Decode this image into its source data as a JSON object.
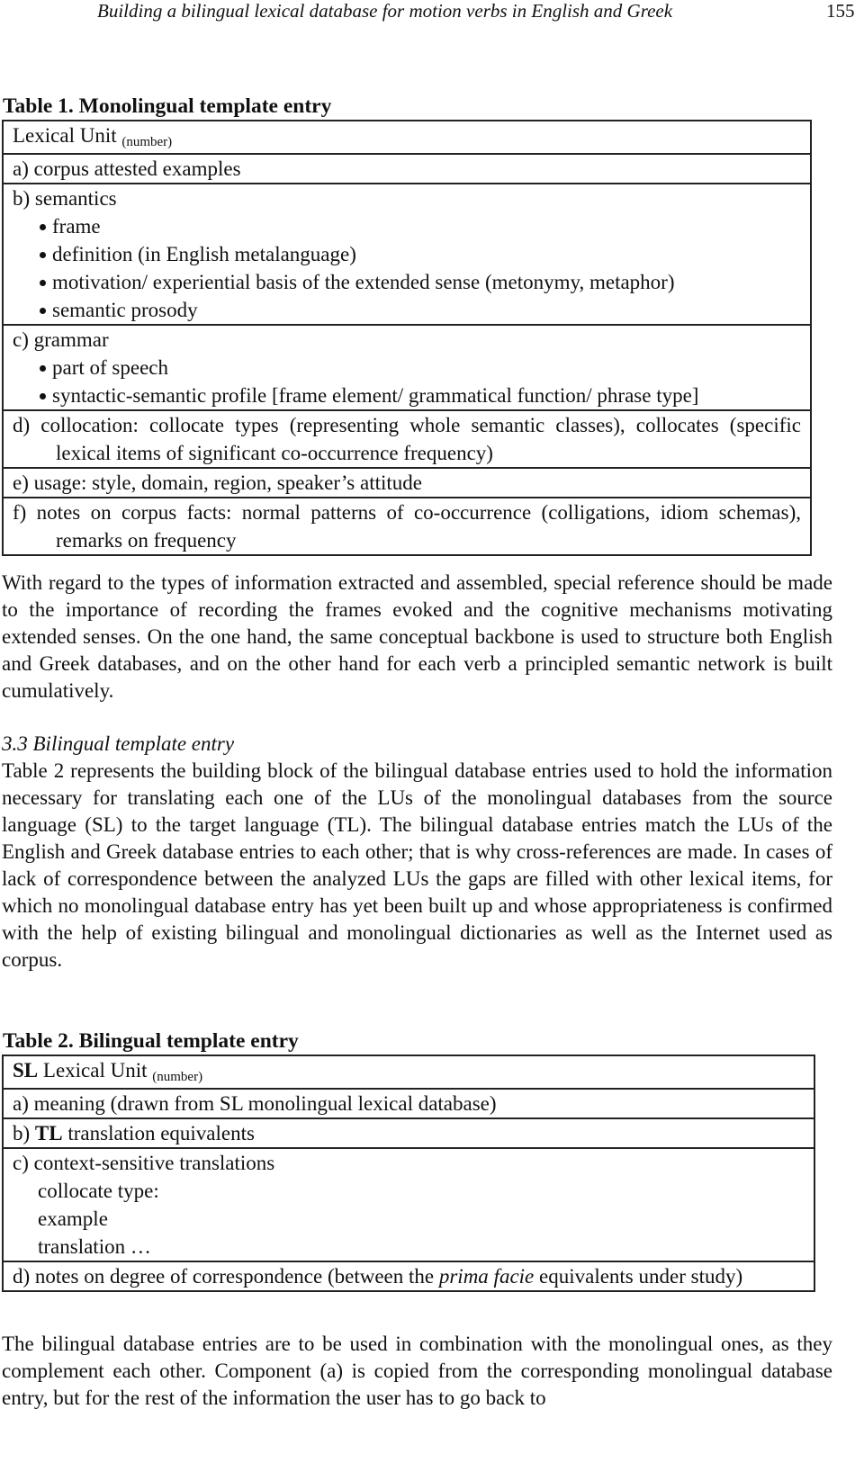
{
  "running_head": {
    "title": "Building a bilingual lexical database for motion verbs in English and Greek",
    "page_number": "155"
  },
  "table1": {
    "caption": "Table 1. Monolingual template entry",
    "header": {
      "text": "Lexical Unit",
      "sub": "(number)"
    },
    "row_a": "a) corpus attested examples",
    "row_b": {
      "label": "b) semantics",
      "bullets": [
        "frame",
        "definition (in English metalanguage)",
        "motivation/ experiential basis of the extended sense (metonymy, metaphor)",
        "semantic prosody"
      ]
    },
    "row_c": {
      "label": "c) grammar",
      "bullets": [
        "part of speech",
        "syntactic-semantic profile [frame element/ grammatical function/ phrase type]"
      ]
    },
    "row_d": "d) collocation: collocate types (representing whole semantic classes), collocates (specific lexical items of significant co-occurrence frequency)",
    "row_e": "e) usage: style, domain, region, speaker’s attitude",
    "row_f": "f) notes on corpus facts: normal patterns of co-occurrence (colligations, idiom schemas), remarks on frequency"
  },
  "paragraph1": "With regard to the types of information extracted and assembled, special reference should be made to the importance of recording the frames evoked and the cognitive mechanisms motivating extended senses. On the one hand, the same conceptual backbone is used to structure both English and Greek databases, and on the other hand for each verb a principled semantic network is built cumulatively.",
  "section_heading": "3.3 Bilingual template entry",
  "paragraph2": "Table 2 represents the building block of the bilingual database entries used to hold the information necessary for translating each one of the LUs of the monolingual databases from the source language (SL) to the target language (TL). The bilingual database entries match the LUs of the English and Greek database entries to each other; that is why cross-references are made. In cases of lack of correspondence between the analyzed LUs the gaps are filled with other lexical items, for which no monolingual database entry has yet been built up and whose appropriateness is confirmed with the help of existing bilingual and monolingual dictionaries as well as the Internet used as corpus.",
  "table2": {
    "caption": "Table 2. Bilingual template entry",
    "header": {
      "bold": "SL",
      "text": " Lexical Unit",
      "sub": "(number)"
    },
    "row_a": "a) meaning (drawn from SL monolingual lexical database)",
    "row_b": {
      "prefix": "b) ",
      "bold": "TL",
      "text": " translation equivalents"
    },
    "row_c": {
      "label": "c) context-sensitive translations",
      "lines": [
        "collocate type:",
        "example",
        "translation …"
      ]
    },
    "row_d": {
      "before": "d) notes on degree of correspondence (between the ",
      "italic": "prima facie",
      "after": " equivalents under study)"
    }
  },
  "paragraph3": "The bilingual database entries are to be used in combination with the monolingual ones, as they complement each other. Component (a) is copied from the corresponding monolingual database entry, but for the rest of the information the user has to go back to"
}
